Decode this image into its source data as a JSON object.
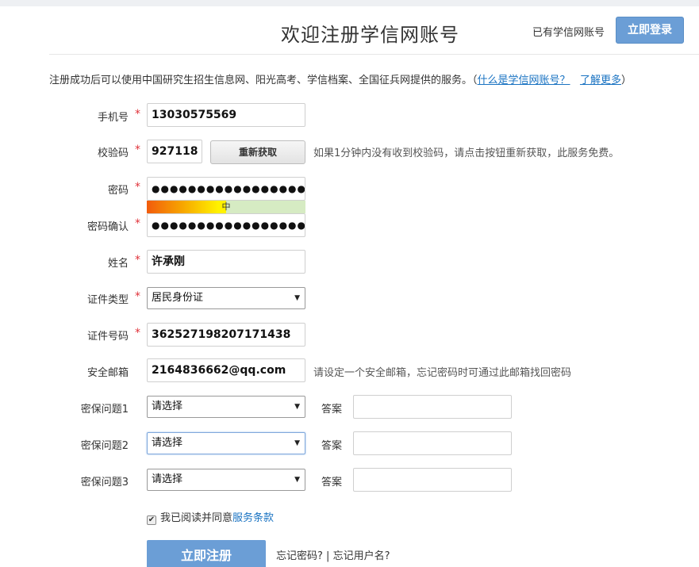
{
  "header": {
    "title": "欢迎注册学信网账号",
    "have_account": "已有学信网账号",
    "login_button": "立即登录"
  },
  "intro": {
    "text": "注册成功后可以使用中国研究生招生信息网、阳光高考、学信档案、全国征兵网提供的服务。（",
    "link1": "什么是学信网账号？",
    "link2": "了解更多",
    "close": "）"
  },
  "form": {
    "phone": {
      "label": "手机号",
      "value": "13030575569"
    },
    "code": {
      "label": "校验码",
      "value": "927118",
      "button": "重新获取",
      "hint": "如果1分钟内没有收到校验码，请点击按钮重新获取，此服务免费。"
    },
    "password": {
      "label": "密码",
      "value": "●●●●●●●●●●●●●●●●●●",
      "strength_label": "中",
      "strength_fraction": 0.5
    },
    "password_confirm": {
      "label": "密码确认",
      "value": "●●●●●●●●●●●●●●●●●●"
    },
    "name": {
      "label": "姓名",
      "value": "许承刚"
    },
    "id_type": {
      "label": "证件类型",
      "value": "居民身份证"
    },
    "id_number": {
      "label": "证件号码",
      "value": "362527198207171438"
    },
    "email": {
      "label": "安全邮箱",
      "value": "2164836662@qq.com",
      "hint": "请设定一个安全邮箱，忘记密码时可通过此邮箱找回密码"
    },
    "security_questions": [
      {
        "label": "密保问题1",
        "value": "请选择",
        "answer_label": "答案",
        "answer": ""
      },
      {
        "label": "密保问题2",
        "value": "请选择",
        "answer_label": "答案",
        "answer": ""
      },
      {
        "label": "密保问题3",
        "value": "请选择",
        "answer_label": "答案",
        "answer": ""
      }
    ],
    "required_mark": "*",
    "dropdown_arrow": "▼"
  },
  "agreement": {
    "checked": true,
    "check_mark": "✔",
    "text": "我已阅读并同意",
    "link": "服务条款"
  },
  "actions": {
    "register": "立即注册",
    "forgot_password": "忘记密码?",
    "separator": " | ",
    "forgot_username": "忘记用户名?"
  },
  "colors": {
    "accent": "#6b9ed6",
    "link": "#1a73c2",
    "required": "#e0323a"
  }
}
